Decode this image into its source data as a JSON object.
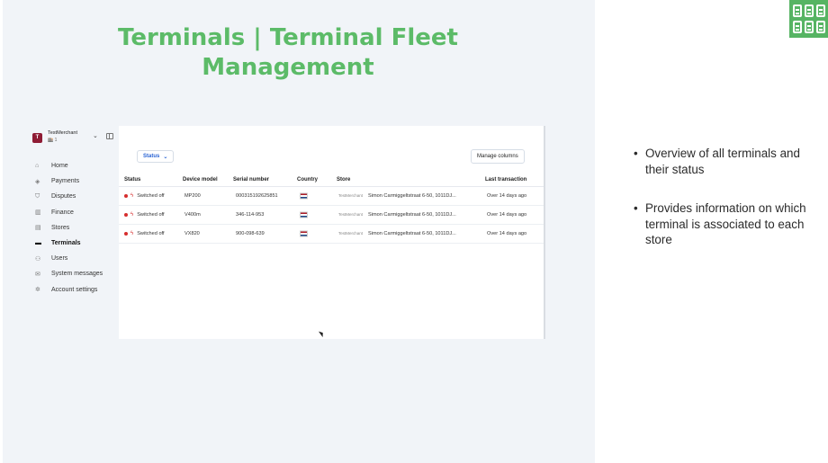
{
  "slide": {
    "title": "Terminals | Terminal Fleet Management",
    "bullets": [
      "Overview of all terminals and their status",
      "Provides information on which terminal is associated to each store"
    ]
  },
  "sidebar": {
    "merchant_initial": "T",
    "merchant_name": "TestMerchant",
    "merchant_sub": "🏬 1",
    "items": [
      {
        "label": "Home",
        "icon": "home-icon"
      },
      {
        "label": "Payments",
        "icon": "payments-icon"
      },
      {
        "label": "Disputes",
        "icon": "disputes-icon"
      },
      {
        "label": "Finance",
        "icon": "finance-icon"
      },
      {
        "label": "Stores",
        "icon": "stores-icon"
      },
      {
        "label": "Terminals",
        "icon": "terminals-icon",
        "active": true
      },
      {
        "label": "Users",
        "icon": "users-icon"
      },
      {
        "label": "System messages",
        "icon": "messages-icon"
      },
      {
        "label": "Account settings",
        "icon": "settings-icon"
      }
    ]
  },
  "toolbar": {
    "status_filter": "Status",
    "manage_columns": "Manage columns"
  },
  "table": {
    "columns": [
      "Status",
      "Device model",
      "Serial number",
      "Country",
      "Store",
      "Last transaction"
    ],
    "rows": [
      {
        "status": "Switched off",
        "model": "MP200",
        "serial": "000315192625851",
        "store_tag": "TestMerchant",
        "store": "Simon Carmiggeltstraat 6-50, 1011DJ...",
        "last": "Over 14 days ago"
      },
      {
        "status": "Switched off",
        "model": "V400m",
        "serial": "346-114-953",
        "store_tag": "TestMerchant",
        "store": "Simon Carmiggeltstraat 6-50, 1011DJ...",
        "last": "Over 14 days ago"
      },
      {
        "status": "Switched off",
        "model": "VX820",
        "serial": "900-098-639",
        "store_tag": "TestMerchant",
        "store": "Simon Carmiggeltstraat 6-50, 1011DJ...",
        "last": "Over 14 days ago"
      }
    ]
  },
  "colors": {
    "title_green": "#5cbb68",
    "status_red": "#d62d2d",
    "link_blue": "#2a64d4"
  }
}
